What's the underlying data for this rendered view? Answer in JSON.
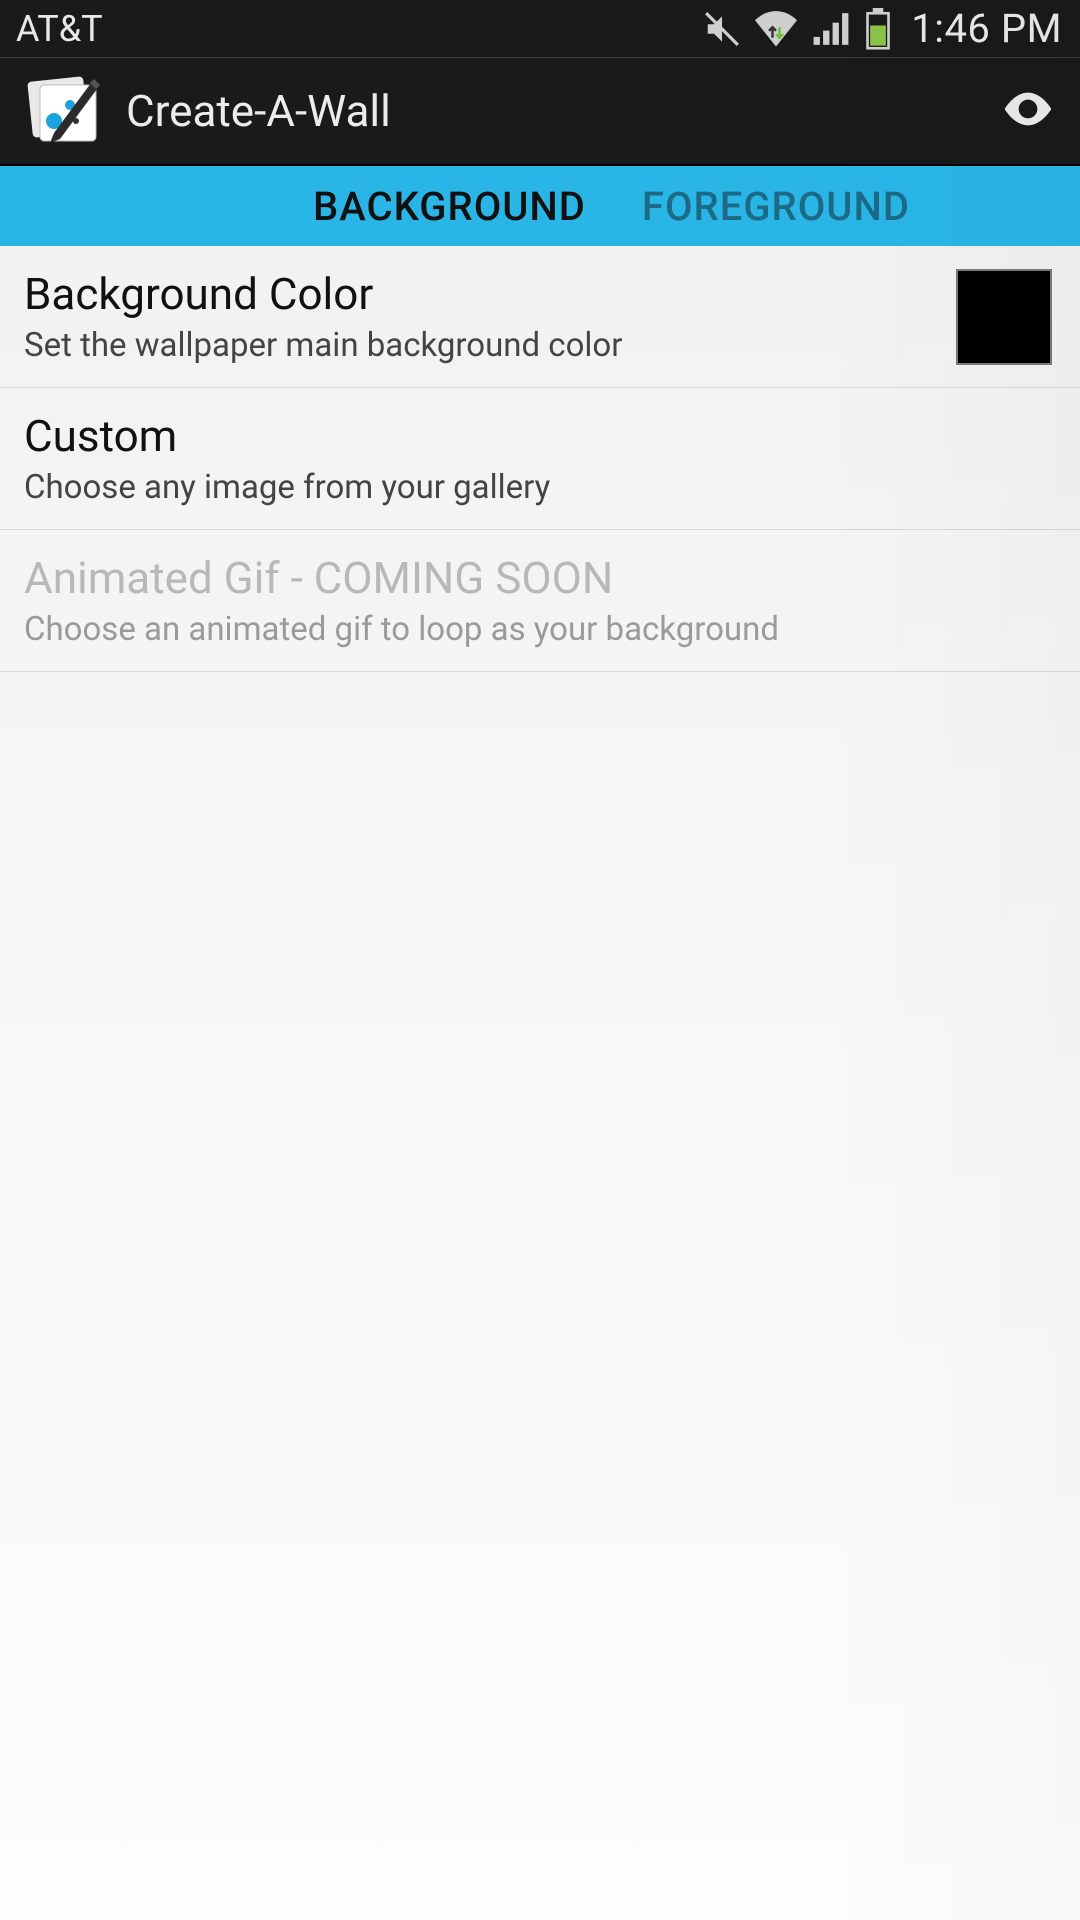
{
  "status": {
    "carrier": "AT&T",
    "time": "1:46 PM"
  },
  "appbar": {
    "title": "Create-A-Wall"
  },
  "tabs": {
    "background": "BACKGROUND",
    "foreground": "FOREGROUND"
  },
  "settings": {
    "bg_color": {
      "title": "Background Color",
      "desc": "Set the wallpaper main background color",
      "swatch": "#000000"
    },
    "custom": {
      "title": "Custom",
      "desc": "Choose any image from your gallery"
    },
    "gif": {
      "title": "Animated Gif - COMING SOON",
      "desc": "Choose an animated gif to loop as your background"
    }
  }
}
